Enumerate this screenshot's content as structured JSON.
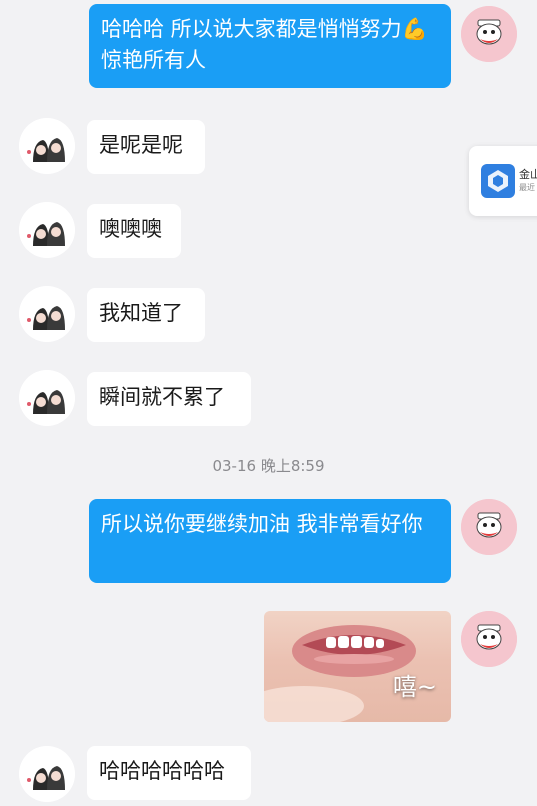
{
  "messages": [
    {
      "side": "me",
      "text": "哈哈哈 所以说大家都是悄悄努力💪惊艳所有人"
    },
    {
      "side": "them",
      "text": "是呢是呢"
    },
    {
      "side": "them",
      "text": "噢噢噢"
    },
    {
      "side": "them",
      "text": "我知道了"
    },
    {
      "side": "them",
      "text": "瞬间就不累了"
    },
    {
      "side": "me",
      "text": "所以说你要继续加油 我非常看好你"
    },
    {
      "side": "me",
      "sticker_caption": "嘻~"
    },
    {
      "side": "them",
      "text": "哈哈哈哈哈哈"
    }
  ],
  "timestamp": "03-16 晚上8:59",
  "floating_card": {
    "title": "金山",
    "subtitle": "最近"
  }
}
